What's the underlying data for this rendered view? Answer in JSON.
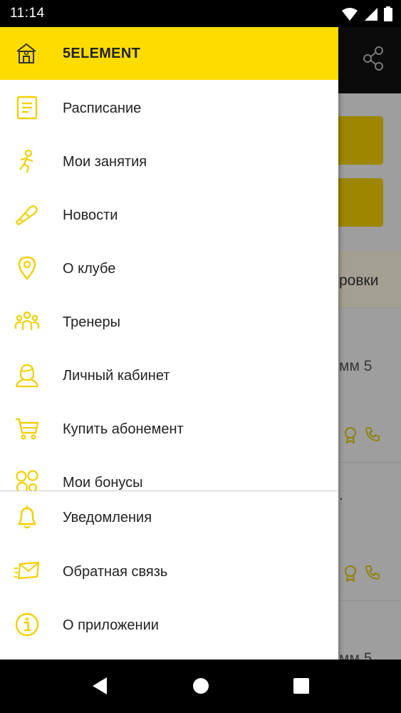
{
  "status_bar": {
    "time": "11:14",
    "icons": [
      "wifi-icon",
      "signal-icon",
      "battery-icon"
    ]
  },
  "colors": {
    "accent": "#ffdc00",
    "toolbar": "#111111",
    "text": "#222222"
  },
  "background": {
    "section_text": "ровки",
    "row1_text": "мм 5",
    "row2_text": ".",
    "row3_text": "мм 5"
  },
  "drawer": {
    "header": {
      "title": "5ELEMENT",
      "icon": "home-icon"
    },
    "items": [
      {
        "label": "Расписание",
        "icon": "schedule-icon"
      },
      {
        "label": "Мои занятия",
        "icon": "running-person-icon"
      },
      {
        "label": "Новости",
        "icon": "megaphone-icon"
      },
      {
        "label": "О клубе",
        "icon": "location-pin-icon"
      },
      {
        "label": "Тренеры",
        "icon": "group-icon"
      },
      {
        "label": "Личный кабинет",
        "icon": "person-icon"
      },
      {
        "label": "Купить абонемент",
        "icon": "cart-icon"
      },
      {
        "label": "Мои бонусы",
        "icon": "bonus-circles-icon"
      }
    ],
    "bottom_items": [
      {
        "label": "Уведомления",
        "icon": "bell-icon"
      },
      {
        "label": "Обратная связь",
        "icon": "feedback-envelope-icon"
      },
      {
        "label": "О приложении",
        "icon": "info-icon"
      }
    ]
  },
  "nav_bar": {
    "buttons": [
      "back-icon",
      "home-circle-icon",
      "recents-icon"
    ]
  }
}
